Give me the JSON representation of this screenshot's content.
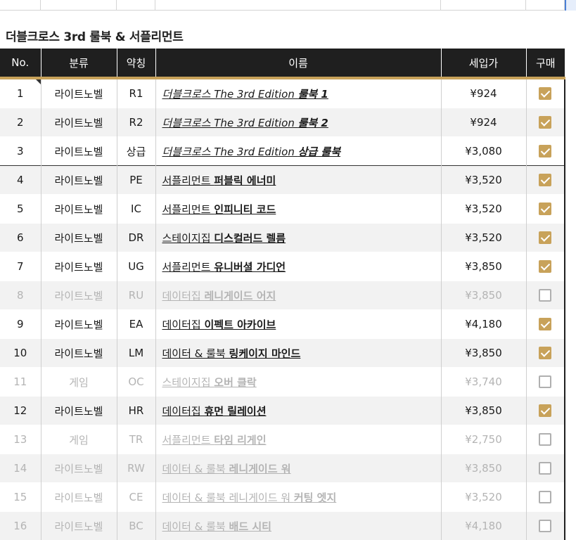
{
  "sheet": {
    "section_title": "더블크로스 3rd 룰북 & 서플리먼트",
    "columns": [
      "No.",
      "분류",
      "약칭",
      "이름",
      "세입가",
      "구매"
    ],
    "rows": [
      {
        "no": "1",
        "category": "라이트노벨",
        "abbr": "R1",
        "name_prefix": "더블크로스 The 3rd Edition ",
        "name_bold": "룰북 1",
        "price": "¥924",
        "bought": true,
        "italic": true,
        "muted": false
      },
      {
        "no": "2",
        "category": "라이트노벨",
        "abbr": "R2",
        "name_prefix": "더블크로스 The 3rd Edition ",
        "name_bold": "룰북 2",
        "price": "¥924",
        "bought": true,
        "italic": true,
        "muted": false
      },
      {
        "no": "3",
        "category": "라이트노벨",
        "abbr": "상급",
        "name_prefix": "더블크로스 The 3rd Edition ",
        "name_bold": "상급 룰북",
        "price": "¥3,080",
        "bought": true,
        "italic": true,
        "muted": false
      },
      {
        "no": "4",
        "category": "라이트노벨",
        "abbr": "PE",
        "name_prefix": "서플리먼트 ",
        "name_bold": "퍼블릭 에너미",
        "price": "¥3,520",
        "bought": true,
        "italic": false,
        "muted": false
      },
      {
        "no": "5",
        "category": "라이트노벨",
        "abbr": "IC",
        "name_prefix": "서플리먼트 ",
        "name_bold": "인피니티 코드",
        "price": "¥3,520",
        "bought": true,
        "italic": false,
        "muted": false
      },
      {
        "no": "6",
        "category": "라이트노벨",
        "abbr": "DR",
        "name_prefix": "스테이지집 ",
        "name_bold": "디스컬러드 렐름",
        "price": "¥3,520",
        "bought": true,
        "italic": false,
        "muted": false
      },
      {
        "no": "7",
        "category": "라이트노벨",
        "abbr": "UG",
        "name_prefix": "서플리먼트 ",
        "name_bold": "유니버셜 가디언",
        "price": "¥3,850",
        "bought": true,
        "italic": false,
        "muted": false
      },
      {
        "no": "8",
        "category": "라이트노벨",
        "abbr": "RU",
        "name_prefix": "데이터집 ",
        "name_bold": "레니게이드 어지",
        "price": "¥3,850",
        "bought": false,
        "italic": false,
        "muted": true
      },
      {
        "no": "9",
        "category": "라이트노벨",
        "abbr": "EA",
        "name_prefix": "데이터집 ",
        "name_bold": "이펙트 아카이브",
        "price": "¥4,180",
        "bought": true,
        "italic": false,
        "muted": false
      },
      {
        "no": "10",
        "category": "라이트노벨",
        "abbr": "LM",
        "name_prefix": "데이터 & 룰북 ",
        "name_bold": "링케이지 마인드",
        "price": "¥3,850",
        "bought": true,
        "italic": false,
        "muted": false
      },
      {
        "no": "11",
        "category": "게임",
        "abbr": "OC",
        "name_prefix": "스테이지집 ",
        "name_bold": "오버 클락",
        "price": "¥3,740",
        "bought": false,
        "italic": false,
        "muted": true
      },
      {
        "no": "12",
        "category": "라이트노벨",
        "abbr": "HR",
        "name_prefix": "데이터집 ",
        "name_bold": "휴먼 릴레이션",
        "price": "¥3,850",
        "bought": true,
        "italic": false,
        "muted": false
      },
      {
        "no": "13",
        "category": "게임",
        "abbr": "TR",
        "name_prefix": "서플리먼트 ",
        "name_bold": "타임 리게인",
        "price": "¥2,750",
        "bought": false,
        "italic": false,
        "muted": true
      },
      {
        "no": "14",
        "category": "라이트노벨",
        "abbr": "RW",
        "name_prefix": "데이터 & 룰북 ",
        "name_bold": "레니게이드 워",
        "price": "¥3,850",
        "bought": false,
        "italic": false,
        "muted": true
      },
      {
        "no": "15",
        "category": "라이트노벨",
        "abbr": "CE",
        "name_prefix": "데이터 & 룰북 레니게이드 워 ",
        "name_bold": "커팅 엣지",
        "price": "¥3,520",
        "bought": false,
        "italic": false,
        "muted": true
      },
      {
        "no": "16",
        "category": "라이트노벨",
        "abbr": "BC",
        "name_prefix": "데이터 & 룰북 ",
        "name_bold": "배드 시티",
        "price": "¥4,180",
        "bought": false,
        "italic": false,
        "muted": true
      }
    ]
  },
  "colors": {
    "header_bg": "#1f1f1f",
    "accent_gold": "#c8a25a",
    "muted_text": "#b4b4b4",
    "row_alt": "#f2f2f2"
  }
}
